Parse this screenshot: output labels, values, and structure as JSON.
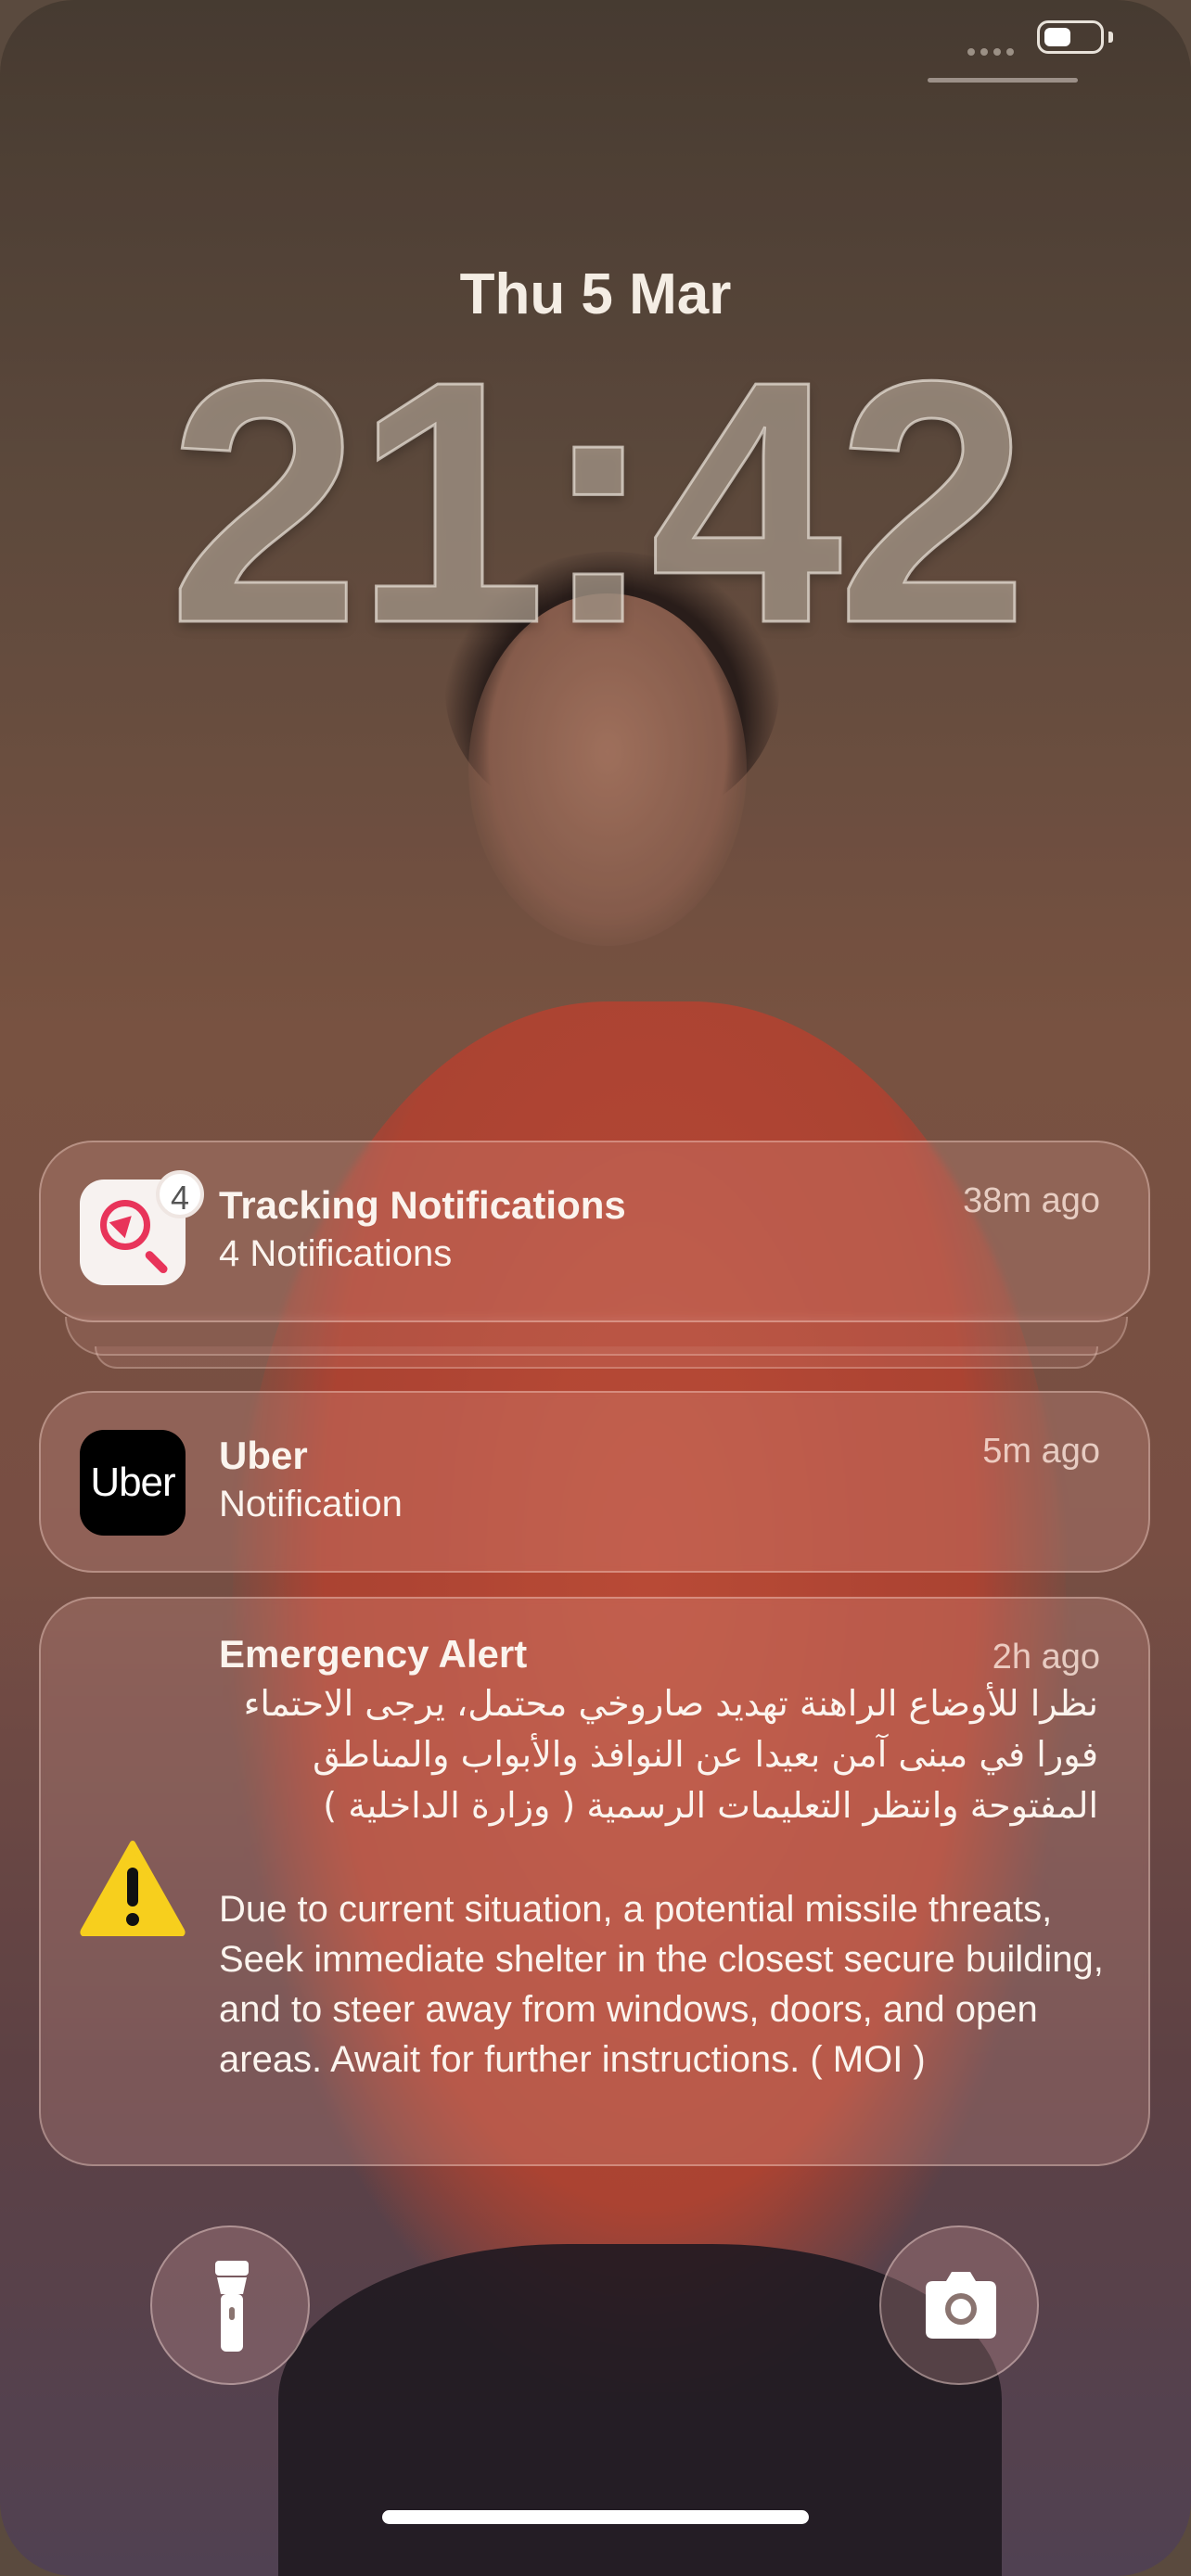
{
  "lockscreen": {
    "date": "Thu 5 Mar",
    "time": "21:42"
  },
  "status_bar": {
    "battery_icon": "battery-icon",
    "signal_icon": "signal-dots-icon"
  },
  "notifications": [
    {
      "app": "Tracking Notifications",
      "summary": "4 Notifications",
      "time_ago": "38m ago",
      "badge_count": "4",
      "icon": "tracking-search-icon"
    },
    {
      "app": "Uber",
      "summary": "Notification",
      "time_ago": "5m ago",
      "icon_text": "Uber"
    },
    {
      "app": "Emergency Alert",
      "time_ago": "2h ago",
      "icon": "warning-triangle-icon",
      "body_arabic": "نظرا للأوضاع الراهنة تهديد صاروخي محتمل، يرجى الاحتماء فورا في مبنى آمن بعيدا عن النوافذ والأبواب والمناطق المفتوحة وانتظر التعليمات الرسمية ( وزارة الداخلية )",
      "body_english": "Due to current situation, a potential missile threats, Seek immediate shelter in the closest secure building, and to steer away from windows, doors, and open areas. Await for further instructions. ( MOI  )"
    }
  ],
  "quick_actions": {
    "left": "flashlight-icon",
    "right": "camera-icon"
  }
}
